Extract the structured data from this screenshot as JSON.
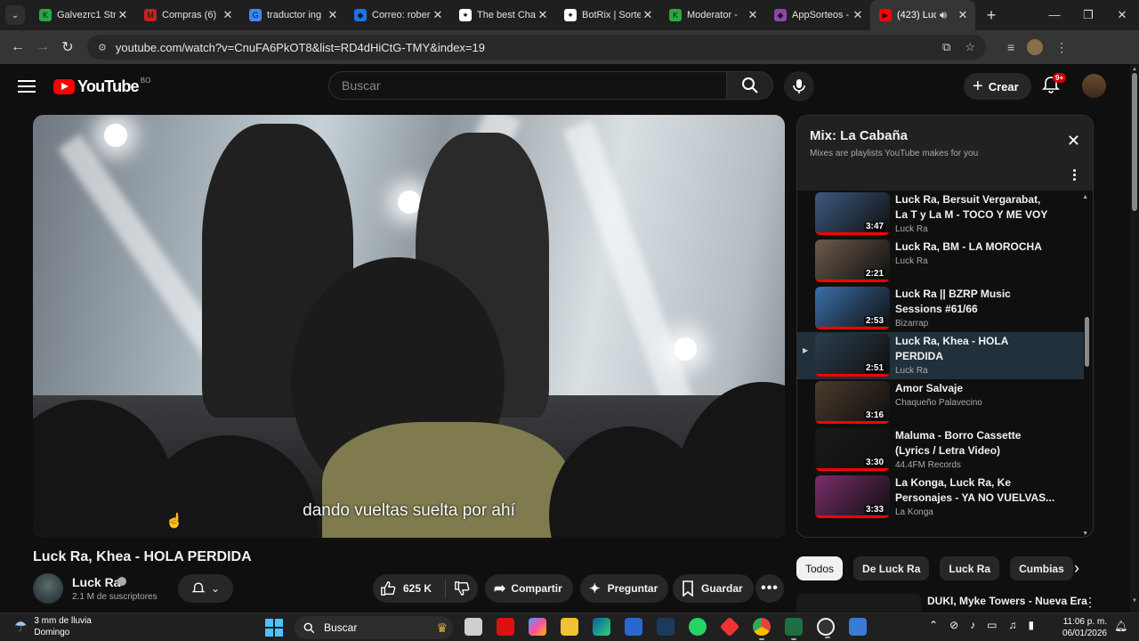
{
  "browser": {
    "tabs": [
      {
        "label": "Galvezrc1 Str",
        "color": "#28a745",
        "glyph": "K"
      },
      {
        "label": "Compras (6)",
        "color": "#c5221f",
        "glyph": "M"
      },
      {
        "label": "traductor ing",
        "color": "#4285f4",
        "glyph": "G"
      },
      {
        "label": "Correo: rober",
        "color": "#1a73e8",
        "glyph": "◆"
      },
      {
        "label": "The best Cha",
        "color": "#ffffff",
        "glyph": "✦"
      },
      {
        "label": "BotRix | Sorte",
        "color": "#ffffff",
        "glyph": "✦"
      },
      {
        "label": "Moderator -",
        "color": "#28a745",
        "glyph": "K"
      },
      {
        "label": "AppSorteos -",
        "color": "#8e44ad",
        "glyph": "◆"
      },
      {
        "label": "(423) Luc",
        "color": "#ff0000",
        "glyph": "▶",
        "active": true
      }
    ],
    "url": "youtube.com/watch?v=CnuFA6PkOT8&list=RD4dHiCtG-TMY&index=19"
  },
  "masthead": {
    "logo_text": "YouTube",
    "country_code": "BO",
    "search_placeholder": "Buscar",
    "create_label": "Crear",
    "notif_badge": "9+"
  },
  "player": {
    "caption": "dando vueltas suelta por ahí"
  },
  "video": {
    "title": "Luck Ra, Khea - HOLA PERDIDA",
    "channel": "Luck Ra",
    "subscribers": "2.1 M de suscriptores",
    "likes": "625 K",
    "share_label": "Compartir",
    "ask_label": "Preguntar",
    "save_label": "Guardar"
  },
  "mix": {
    "title": "Mix: La Cabaña",
    "subtitle": "Mixes are playlists YouTube makes for you",
    "items": [
      {
        "title": "Luck Ra, Bersuit Vergarabat, La T y La M - TOCO Y ME VOY",
        "channel": "Luck Ra",
        "duration": "3:47",
        "thumb": "#3d5a80",
        "current": false
      },
      {
        "title": "Luck Ra, BM - LA MOROCHA",
        "channel": "Luck Ra",
        "duration": "2:21",
        "thumb": "#6b5b4b",
        "current": false
      },
      {
        "title": "Luck Ra || BZRP Music Sessions #61/66",
        "channel": "Bizarrap",
        "duration": "2:53",
        "thumb": "#3b6fa8",
        "current": false
      },
      {
        "title": "Luck Ra, Khea - HOLA PERDIDA",
        "channel": "Luck Ra",
        "duration": "2:51",
        "thumb": "#2c3e50",
        "current": true
      },
      {
        "title": "Amor Salvaje",
        "channel": "Chaqueño Palavecino",
        "duration": "3:16",
        "thumb": "#4a3b2c",
        "current": false
      },
      {
        "title": "Maluma - Borro Cassette (Lyrics / Letra Video)",
        "channel": "44.4FM Records",
        "duration": "3:30",
        "thumb": "#1a1a1a",
        "current": false
      },
      {
        "title": "La Konga, Luck Ra, Ke Personajes - YA NO VUELVAS...",
        "channel": "La Konga",
        "duration": "3:33",
        "thumb": "#7b2d6b",
        "current": false
      }
    ]
  },
  "chips": [
    "Todos",
    "De Luck Ra",
    "Luck Ra",
    "Cumbias"
  ],
  "next_video": {
    "title": "DUKI, Myke Towers - Nueva Era"
  },
  "taskbar": {
    "weather_line1": "3 mm de lluvia",
    "weather_line2": "Domingo",
    "search_label": "Buscar",
    "time": "11:06 p. m.",
    "date": "06/01/2026"
  }
}
